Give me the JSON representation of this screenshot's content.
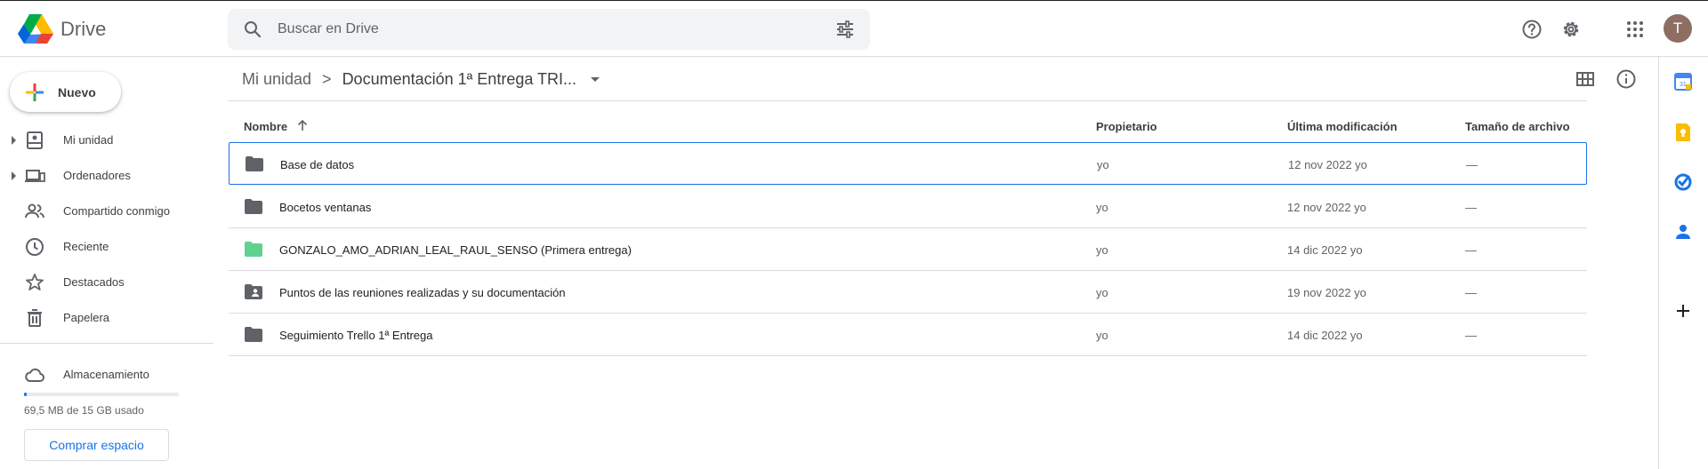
{
  "header": {
    "brand": "Drive",
    "search_placeholder": "Buscar en Drive",
    "avatar_letter": "T"
  },
  "sidebar": {
    "new_label": "Nuevo",
    "items": [
      {
        "label": "Mi unidad",
        "icon": "my-drive-icon"
      },
      {
        "label": "Ordenadores",
        "icon": "computers-icon"
      },
      {
        "label": "Compartido conmigo",
        "icon": "shared-icon"
      },
      {
        "label": "Reciente",
        "icon": "clock-icon"
      },
      {
        "label": "Destacados",
        "icon": "star-icon"
      },
      {
        "label": "Papelera",
        "icon": "trash-icon"
      }
    ],
    "storage_label": "Almacenamiento",
    "storage_used_text": "69,5 MB de 15 GB usado",
    "storage_fraction": 0.005,
    "buy_label": "Comprar espacio"
  },
  "breadcrumb": {
    "root": "Mi unidad",
    "separator": ">",
    "current": "Documentación 1ª Entrega TRI..."
  },
  "table": {
    "headers": {
      "name": "Nombre",
      "owner": "Propietario",
      "modified": "Última modificación",
      "size": "Tamaño de archivo"
    },
    "rows": [
      {
        "name": "Base de datos",
        "owner": "yo",
        "modified": "12 nov 2022 yo",
        "size": "—",
        "folder_type": "folder",
        "color": "#5f6368"
      },
      {
        "name": "Bocetos ventanas",
        "owner": "yo",
        "modified": "12 nov 2022 yo",
        "size": "—",
        "folder_type": "folder",
        "color": "#5f6368"
      },
      {
        "name": "GONZALO_AMO_ADRIAN_LEAL_RAUL_SENSO (Primera entrega)",
        "owner": "yo",
        "modified": "14 dic 2022 yo",
        "size": "—",
        "folder_type": "folder",
        "color": "#5fd28f"
      },
      {
        "name": "Puntos de las reuniones realizadas y su documentación",
        "owner": "yo",
        "modified": "19 nov 2022 yo",
        "size": "—",
        "folder_type": "shared-folder",
        "color": "#5f6368"
      },
      {
        "name": "Seguimiento Trello 1ª Entrega",
        "owner": "yo",
        "modified": "14 dic 2022 yo",
        "size": "—",
        "folder_type": "folder",
        "color": "#5f6368"
      }
    ]
  },
  "rail": {
    "icons": [
      "calendar-icon",
      "keep-icon",
      "tasks-icon",
      "contacts-icon",
      "add-icon"
    ]
  },
  "colors": {
    "accent": "#1a73e8",
    "text": "#3c4043",
    "muted": "#5f6368"
  }
}
